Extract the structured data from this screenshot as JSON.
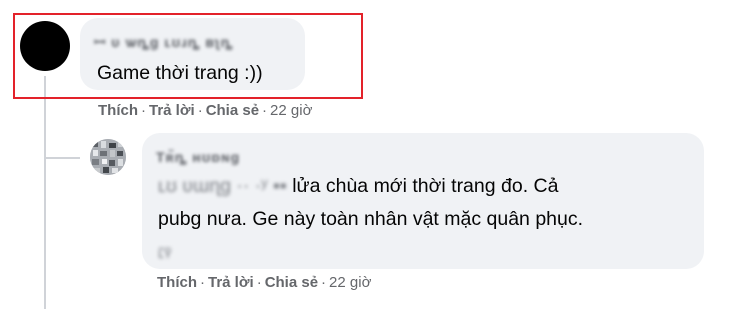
{
  "comment1": {
    "author": "ꟷ ᴜ ѡȵɡ ʟʊɹȵ ʙʅȵ",
    "text": "Game thời trang :))",
    "actions": {
      "like": "Thích",
      "reply": "Trả lời",
      "share": "Chia sẻ",
      "time": "22 giờ"
    }
  },
  "reply1": {
    "author": "Tʀ̃ȵ ʜʊɒɴɡ",
    "text_blur_prefix": "ʟʊ ʋɯɳɡ ·· ·ʸ   ▪▪",
    "text_line1": " lửa chùa mới thời trang đo. Cả",
    "text_line2": "pubg nưa. Ge này toàn nhân vật mặc quân phục.",
    "text_blur_suffix": "ʟ̃ʏ̃",
    "actions": {
      "like": "Thích",
      "reply": "Trả lời",
      "share": "Chia sẻ",
      "time": "22 giờ"
    }
  },
  "colors": {
    "highlight": "#e3222a",
    "bubble": "#f0f2f5",
    "meta": "#65676b"
  }
}
